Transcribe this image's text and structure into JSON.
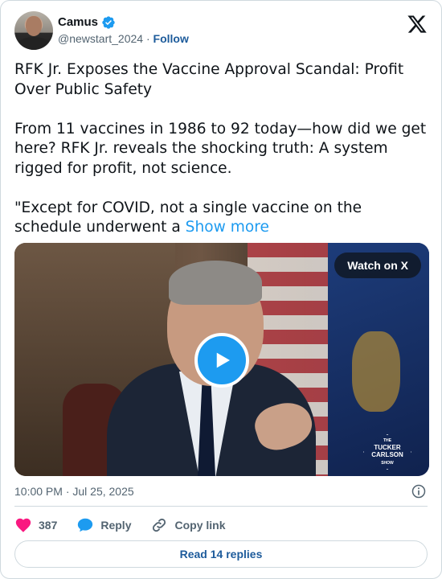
{
  "author": {
    "name": "Camus",
    "handle": "@newstart_2024",
    "separator": " · ",
    "follow_label": "Follow",
    "verified": true
  },
  "tweet": {
    "text": "RFK Jr. Exposes the Vaccine Approval Scandal: Profit Over Public Safety\n\nFrom 11 vaccines in 1986 to 92 today—how did we get here? RFK Jr. reveals the shocking truth: A system rigged for profit, not science.\n\n\"Except for COVID, not a single vaccine on the schedule underwent a ",
    "show_more_label": "Show more"
  },
  "media": {
    "watch_label": "Watch on X",
    "watermark": {
      "top": "THE",
      "line1": "TUCKER",
      "line2": "CARLSON",
      "bottom": "SHOW"
    }
  },
  "meta": {
    "timestamp": "10:00 PM · Jul 25, 2025"
  },
  "actions": {
    "like_count": "387",
    "reply_label": "Reply",
    "copy_label": "Copy link"
  },
  "footer": {
    "read_replies_label": "Read 14 replies"
  },
  "colors": {
    "accent": "#1d9bf0",
    "link_dark": "#1d5b9b",
    "like": "#f91880",
    "muted": "#536471",
    "border": "#cfd9de"
  },
  "icons": {
    "verified": "verified-badge-icon",
    "logo": "x-logo-icon",
    "play": "play-icon",
    "info": "info-icon",
    "like": "heart-icon",
    "reply": "speech-bubble-icon",
    "copy": "link-icon"
  }
}
